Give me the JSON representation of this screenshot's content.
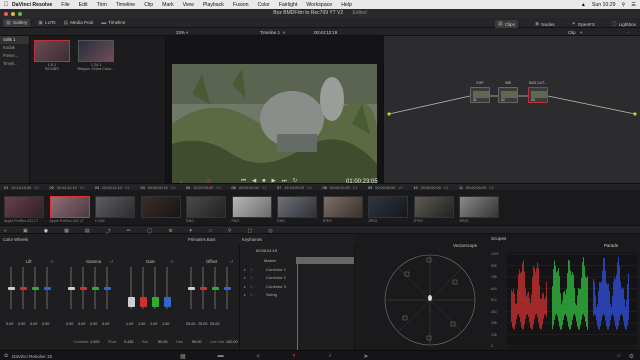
{
  "menubar": {
    "app": "DaVinci Resolve",
    "items": [
      "File",
      "Edit",
      "Trim",
      "Timeline",
      "Clip",
      "Mark",
      "View",
      "Playback",
      "Fusion",
      "Color",
      "Fairlight",
      "Workspace",
      "Help"
    ],
    "clock": "Sun 10:29"
  },
  "window": {
    "title": "Boz BMDFilm to Rec709 YT V2",
    "status": "Edited"
  },
  "toolbar": {
    "gallery": "Gallery",
    "luts": "LUTs",
    "media_pool": "Media Pool",
    "timeline": "Timeline",
    "clips": "Clips",
    "nodes": "Nodes",
    "openfx": "OpenFX",
    "lightbox": "Lightbox"
  },
  "subbar": {
    "zoom": "33%",
    "timeline_name": "Timeline 1",
    "timecode": "00:44:12:19",
    "clip_label": "Clip"
  },
  "gallery": {
    "sidebar": [
      "Stills 1",
      "Kodak",
      "Power...",
      "Timeli..."
    ],
    "stills": [
      {
        "label": "1.8.1",
        "sub": "BOOBS"
      },
      {
        "label": "1.24.1",
        "sub": "Birspon China Color..."
      }
    ]
  },
  "viewer": {
    "timecode": "01:00:23:05"
  },
  "nodes": [
    {
      "label": "EXP",
      "num": "01"
    },
    {
      "label": "WB",
      "num": "02"
    },
    {
      "label": "BOZ LUT...",
      "num": "03"
    }
  ],
  "clips": [
    {
      "n": "01",
      "tc": "10:16:15:05",
      "v": "V1",
      "codec": "Apple ProRes 422 LT"
    },
    {
      "n": "02",
      "tc": "00:44:12:19",
      "v": "V1",
      "codec": "Apple ProRes 422 LT"
    },
    {
      "n": "03",
      "tc": "00:00:11:10",
      "v": "V1",
      "codec": "H.264"
    },
    {
      "n": "04",
      "tc": "00:00:00:15",
      "v": "V1",
      "codec": ""
    },
    {
      "n": "05",
      "tc": "19:20:00:00",
      "v": "V1",
      "codec": "DNG"
    },
    {
      "n": "06",
      "tc": "00:00:00:00",
      "v": "V1",
      "codec": "PNG"
    },
    {
      "n": "07",
      "tc": "16:18:00:29",
      "v": "V1",
      "codec": "DNG"
    },
    {
      "n": "08",
      "tc": "00:00:00:00",
      "v": "V1",
      "codec": "JPEG"
    },
    {
      "n": "09",
      "tc": "00:00:00:00",
      "v": "V1",
      "codec": "JPEG"
    },
    {
      "n": "10",
      "tc": "00:00:00:00",
      "v": "V1",
      "codec": "JPEG"
    },
    {
      "n": "11",
      "tc": "00:00:00:00",
      "v": "V1",
      "codec": "JPEG"
    }
  ],
  "wheels": {
    "title": "Color Wheels",
    "primaries": "Primaries Bars",
    "groups": [
      {
        "name": "Lift",
        "values": [
          "0.00",
          "0.00",
          "0.00",
          "0.00"
        ]
      },
      {
        "name": "Gamma",
        "values": [
          "0.00",
          "0.00",
          "0.00",
          "0.00"
        ]
      },
      {
        "name": "Gain",
        "values": [
          "1.00",
          "1.00",
          "1.00",
          "1.00"
        ]
      },
      {
        "name": "Offset",
        "values": [
          "25.00",
          "25.00",
          "25.00",
          ""
        ]
      }
    ],
    "footer": [
      {
        "k": "Contrast",
        "v": "1.000"
      },
      {
        "k": "Pivot",
        "v": "0.435"
      },
      {
        "k": "Sat",
        "v": "50.00"
      },
      {
        "k": "Hue",
        "v": "50.00"
      },
      {
        "k": "Lum Mix",
        "v": "100.00"
      }
    ]
  },
  "keyframes": {
    "title": "Keyframes",
    "timecode": "00:00:01:19",
    "rows": [
      "Master",
      "Corrector 1",
      "Corrector 2",
      "Corrector 3",
      "Sizing"
    ]
  },
  "scopes": {
    "title": "Scopes",
    "left_mode": "Vectorscope",
    "right_mode": "Parade",
    "yaxis": [
      "1023",
      "896",
      "768",
      "640",
      "512",
      "384",
      "256",
      "128",
      "0"
    ]
  },
  "bottombar": {
    "app": "DaVinci Resolve 15"
  }
}
